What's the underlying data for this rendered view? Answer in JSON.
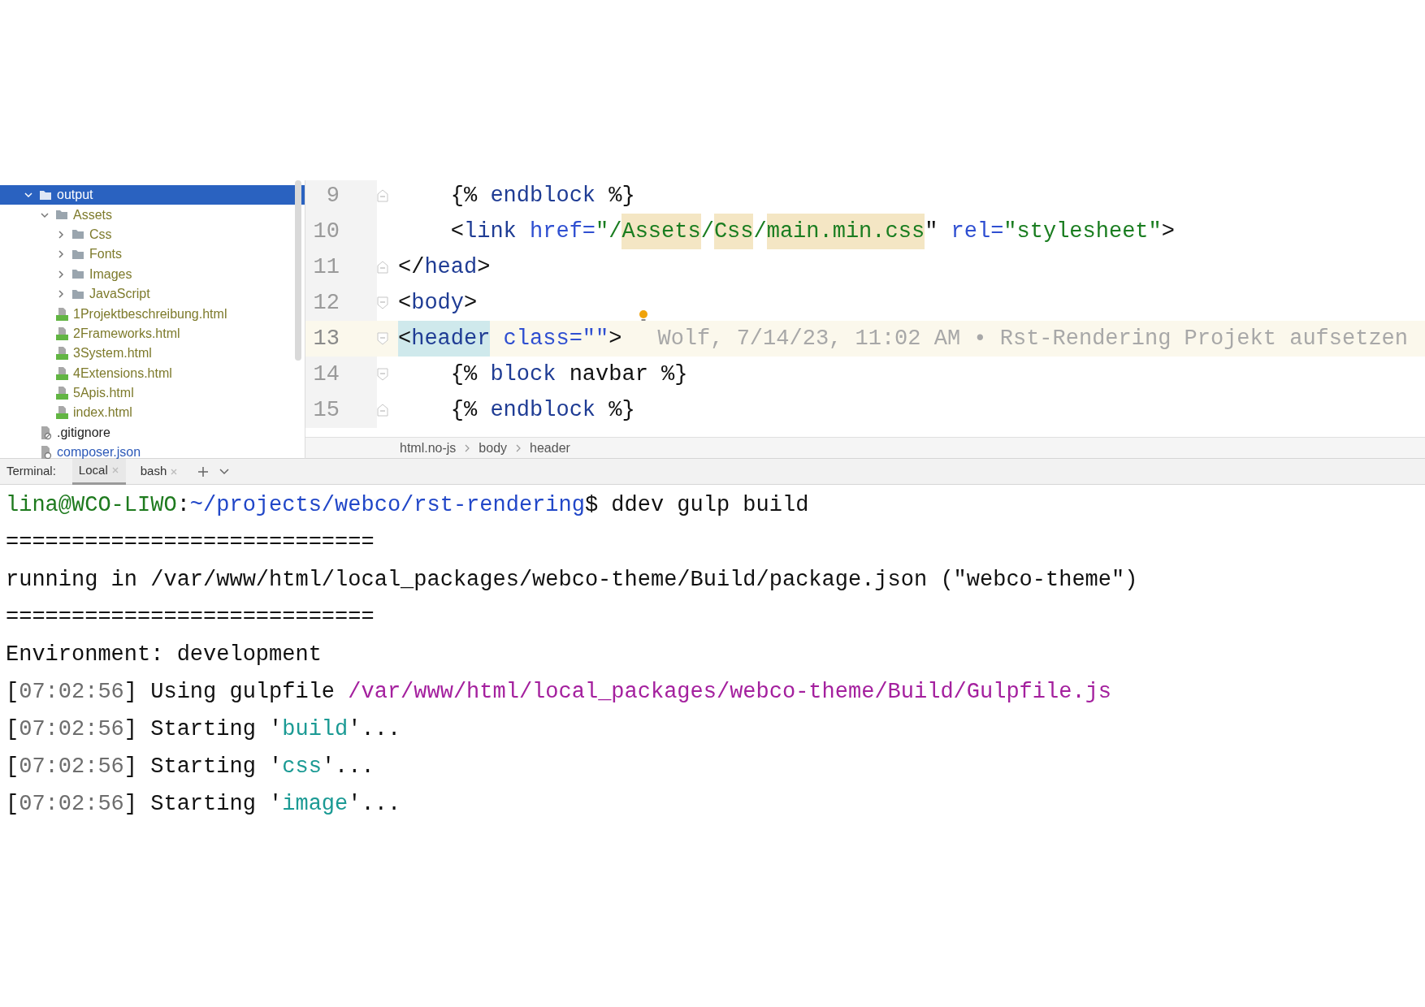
{
  "project_tree": [
    {
      "label": "output",
      "kind": "folder",
      "expanded": true,
      "selected": true,
      "children": [
        {
          "label": "Assets",
          "kind": "folder",
          "color": "#7d7a2b",
          "expanded": true,
          "selected": false,
          "children": [
            {
              "label": "Css",
              "kind": "folder",
              "color": "#7d7a2b",
              "expanded": false,
              "selected": false
            },
            {
              "label": "Fonts",
              "kind": "folder",
              "color": "#7d7a2b",
              "expanded": false,
              "selected": false
            },
            {
              "label": "Images",
              "kind": "folder",
              "color": "#7d7a2b",
              "expanded": false,
              "selected": false
            },
            {
              "label": "JavaScript",
              "kind": "folder",
              "color": "#7d7a2b",
              "expanded": false,
              "selected": false
            }
          ]
        },
        {
          "label": "1Projektbeschreibung.html",
          "kind": "html",
          "color": "#7d7a2b",
          "selected": false
        },
        {
          "label": "2Frameworks.html",
          "kind": "html",
          "color": "#7d7a2b",
          "selected": false
        },
        {
          "label": "3System.html",
          "kind": "html",
          "color": "#7d7a2b",
          "selected": false
        },
        {
          "label": "4Extensions.html",
          "kind": "html",
          "color": "#7d7a2b",
          "selected": false
        },
        {
          "label": "5Apis.html",
          "kind": "html",
          "color": "#7d7a2b",
          "selected": false
        },
        {
          "label": "index.html",
          "kind": "html",
          "color": "#7d7a2b",
          "selected": false
        }
      ]
    },
    {
      "label": ".gitignore",
      "kind": "gitignore",
      "color": "#222222",
      "selected": false
    },
    {
      "label": "composer.json",
      "kind": "json",
      "color": "#2c59b8",
      "selected": false
    }
  ],
  "editor": {
    "lines": [
      {
        "number": "9",
        "fold_start": false,
        "current": false,
        "tokens": [
          {
            "text": "    {% ",
            "kind": "plain"
          },
          {
            "text": "endblock",
            "kind": "keyword"
          },
          {
            "text": " %}",
            "kind": "plain"
          }
        ]
      },
      {
        "number": "10",
        "current": false,
        "tokens": [
          {
            "text": "    <",
            "kind": "plain"
          },
          {
            "text": "link",
            "kind": "tag"
          },
          {
            "text": " href=",
            "kind": "attr"
          },
          {
            "text": "\"/",
            "kind": "string"
          },
          {
            "text": "Assets",
            "kind": "string",
            "matched": true
          },
          {
            "text": "/",
            "kind": "string"
          },
          {
            "text": "Css",
            "kind": "string",
            "matched": true
          },
          {
            "text": "/",
            "kind": "string"
          },
          {
            "text": "main.min.css",
            "kind": "string",
            "matched": true
          },
          {
            "text": "\"",
            "kind": "plain"
          },
          {
            "text": " rel=",
            "kind": "attr"
          },
          {
            "text": "\"stylesheet\"",
            "kind": "string"
          },
          {
            "text": ">",
            "kind": "plain"
          }
        ]
      },
      {
        "number": "11",
        "fold_start": false,
        "current": false,
        "tokens": [
          {
            "text": "</",
            "kind": "plain"
          },
          {
            "text": "head",
            "kind": "tag"
          },
          {
            "text": ">",
            "kind": "plain"
          }
        ]
      },
      {
        "number": "12",
        "fold_start": true,
        "current": false,
        "tokens": [
          {
            "text": "<",
            "kind": "plain"
          },
          {
            "text": "body",
            "kind": "tag"
          },
          {
            "text": ">",
            "kind": "plain"
          }
        ]
      },
      {
        "number": "13",
        "fold_start": true,
        "current": true,
        "blame": "Wolf, 7/14/23, 11:02 AM • Rst-Rendering Projekt aufsetzen",
        "tokens": [
          {
            "text": "<",
            "kind": "plain",
            "matched": true
          },
          {
            "text": "header",
            "kind": "tag",
            "matched": true
          },
          {
            "text": " class=\"\"",
            "kind": "attr"
          },
          {
            "text": ">",
            "kind": "plain"
          }
        ]
      },
      {
        "number": "14",
        "fold_start": true,
        "current": false,
        "tokens": [
          {
            "text": "    {% ",
            "kind": "plain"
          },
          {
            "text": "block",
            "kind": "keyword"
          },
          {
            "text": " navbar %}",
            "kind": "plain"
          }
        ]
      },
      {
        "number": "15",
        "fold_start": false,
        "current": false,
        "tokens": [
          {
            "text": "    {% ",
            "kind": "plain"
          },
          {
            "text": "endblock",
            "kind": "keyword"
          },
          {
            "text": " %}",
            "kind": "plain"
          }
        ]
      }
    ],
    "breadcrumbs": [
      "html.no-js",
      "body",
      "header"
    ]
  },
  "terminal": {
    "label": "Terminal:",
    "tabs": [
      {
        "label": "Local",
        "selected": true
      },
      {
        "label": "bash",
        "selected": false
      }
    ],
    "lines": [
      [
        {
          "text": "lina@WCO-LIWO",
          "kind": "user"
        },
        {
          "text": ":",
          "kind": "plain"
        },
        {
          "text": "~/projects/webco/rst-rendering",
          "kind": "dir"
        },
        {
          "text": "$ ddev gulp build",
          "kind": "plain"
        }
      ],
      [
        {
          "text": "============================",
          "kind": "plain"
        }
      ],
      [
        {
          "text": "running in /var/www/html/local_packages/webco-theme/Build/package.json (\"webco-theme\")",
          "kind": "plain"
        }
      ],
      [
        {
          "text": "============================",
          "kind": "plain"
        }
      ],
      [
        {
          "text": "Environment: development",
          "kind": "plain"
        }
      ],
      [
        {
          "text": "[",
          "kind": "plain"
        },
        {
          "text": "07:02:56",
          "kind": "time"
        },
        {
          "text": "] Using gulpfile ",
          "kind": "plain"
        },
        {
          "text": "/var/www/html/local_packages/webco-theme/Build/Gulpfile.js",
          "kind": "path"
        }
      ],
      [
        {
          "text": "[",
          "kind": "plain"
        },
        {
          "text": "07:02:56",
          "kind": "time"
        },
        {
          "text": "] Starting '",
          "kind": "plain"
        },
        {
          "text": "build",
          "kind": "task"
        },
        {
          "text": "'...",
          "kind": "plain"
        }
      ],
      [
        {
          "text": "[",
          "kind": "plain"
        },
        {
          "text": "07:02:56",
          "kind": "time"
        },
        {
          "text": "] Starting '",
          "kind": "plain"
        },
        {
          "text": "css",
          "kind": "task"
        },
        {
          "text": "'...",
          "kind": "plain"
        }
      ],
      [
        {
          "text": "[",
          "kind": "plain"
        },
        {
          "text": "07:02:56",
          "kind": "time"
        },
        {
          "text": "] Starting '",
          "kind": "plain"
        },
        {
          "text": "image",
          "kind": "task"
        },
        {
          "text": "'...",
          "kind": "plain"
        }
      ]
    ]
  }
}
